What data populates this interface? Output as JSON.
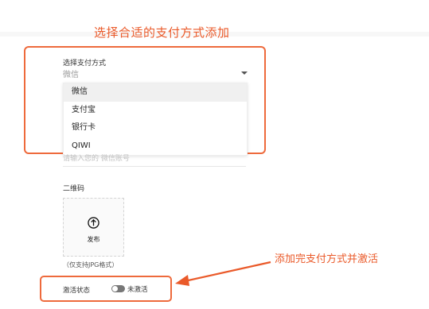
{
  "annotations": {
    "top": "选择合适的支付方式添加",
    "bottom": "添加完支付方式并激活",
    "accent_color": "#ea5a2a"
  },
  "payment_method": {
    "label": "选择支付方式",
    "selected_value": "微信",
    "options": [
      "微信",
      "支付宝",
      "银行卡",
      "QIWI"
    ]
  },
  "account": {
    "placeholder": "请输入您的 微信账号"
  },
  "qr_code": {
    "label": "二维码",
    "upload_icon": "upload-arrow-icon",
    "upload_label": "发布",
    "hint": "（仅支持JPG格式）"
  },
  "activation": {
    "label": "激活状态",
    "toggle_text": "未激活",
    "active": false
  }
}
